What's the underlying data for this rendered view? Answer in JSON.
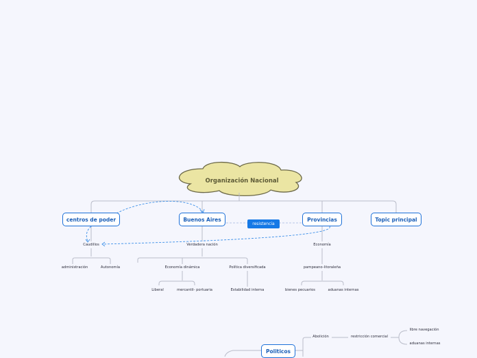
{
  "root": {
    "title": "Organización Nacional"
  },
  "topics": {
    "centros": "centros de poder",
    "buenos_aires": "Buenos Aires",
    "provincias": "Provincias",
    "topic": "Topic principal",
    "politicos": "Politicos"
  },
  "relationship": {
    "label": "resistencia"
  },
  "subtopics": {
    "caudillos": "Caudillos",
    "administracion": "administración",
    "autonomia": "Autonomía",
    "verdadera_nacion": "Verdadera nación",
    "economia_dinamica": "Economía dinámica",
    "politica_diversificada": "Política diversificada",
    "liberal": "Liberal",
    "mercantil": "mercantil- portuaria",
    "estabilidad": "Estabilidad interna",
    "economia": "Economía",
    "pampeano": "pampeano-litoraleña",
    "bienes": "bienes pecuarios",
    "aduanas_internas_1": "aduanas internas",
    "abolicion": "Abolición",
    "restriccion": "restricción comercial",
    "libre_navegacion": "libre navegación",
    "aduanas_internas_2": "aduanas internas"
  },
  "colors": {
    "topic_border": "#1b6fd8",
    "cloud_fill": "#ebe5a3",
    "connector": "#b9bcc9",
    "relationship": "#3b8fe8"
  }
}
